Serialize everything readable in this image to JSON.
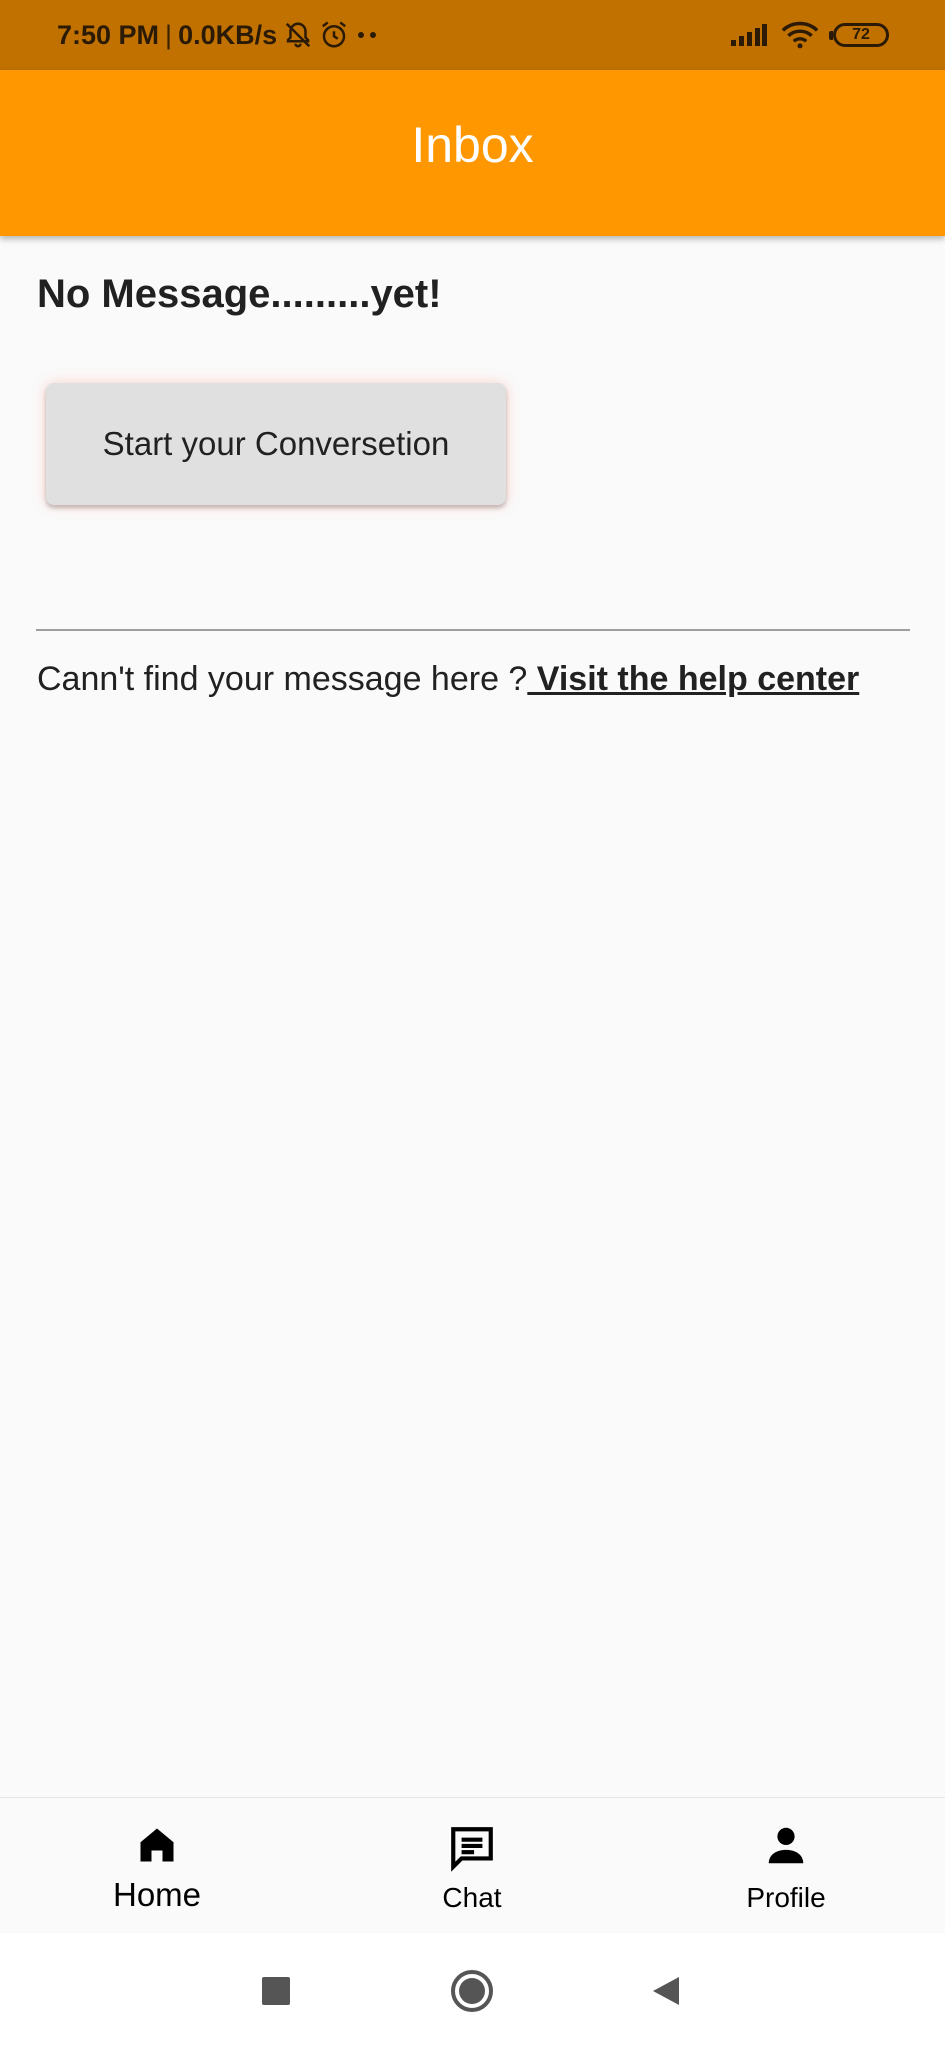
{
  "status_bar": {
    "time": "7:50 PM",
    "separator": "|",
    "network_speed": "0.0KB/s",
    "icons": [
      "notifications-off-icon",
      "alarm-icon",
      "more-dots-icon",
      "signal-icon",
      "wifi-icon"
    ],
    "battery_level": "72"
  },
  "app_bar": {
    "title": "Inbox",
    "color": "#ff9800"
  },
  "main": {
    "heading": "No Message.........yet!",
    "start_button_label": "Start your Conversetion",
    "help_text": "Cann't find your message here ?",
    "help_link": " Visit the help center"
  },
  "bottom_nav": {
    "items": [
      {
        "label": "Home",
        "icon": "home-icon"
      },
      {
        "label": "Chat",
        "icon": "chat-icon"
      },
      {
        "label": "Profile",
        "icon": "profile-icon"
      }
    ]
  },
  "system_nav": {
    "buttons": [
      "recents-icon",
      "home-circle-icon",
      "back-icon"
    ]
  }
}
